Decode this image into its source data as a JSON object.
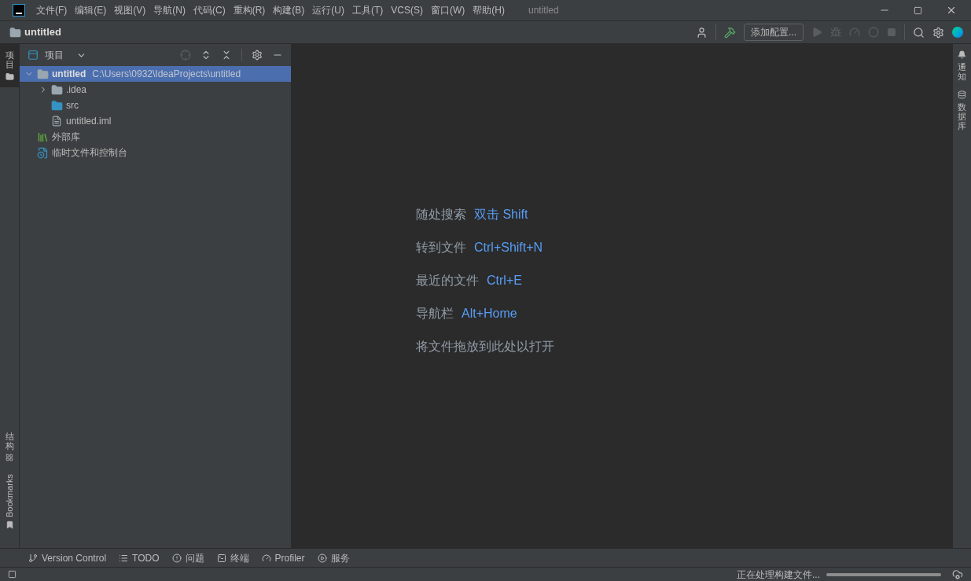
{
  "title_bar": {
    "title": "untitled",
    "menu": [
      "文件(F)",
      "编辑(E)",
      "视图(V)",
      "导航(N)",
      "代码(C)",
      "重构(R)",
      "构建(B)",
      "运行(U)",
      "工具(T)",
      "VCS(S)",
      "窗口(W)",
      "帮助(H)"
    ]
  },
  "nav_bar": {
    "project": "untitled",
    "config_button": "添加配置..."
  },
  "left_stripe": [
    {
      "label": "项目",
      "kind": "cjk",
      "selected": true
    },
    {
      "label": "结构",
      "kind": "cjk",
      "selected": false
    },
    {
      "label": "Bookmarks",
      "kind": "latin",
      "selected": false
    }
  ],
  "project_panel": {
    "title": "项目",
    "tree": [
      {
        "label": "untitled",
        "path": "C:\\Users\\0932\\IdeaProjects\\untitled",
        "kind": "module",
        "expanded": true,
        "selected": true,
        "children": [
          {
            "label": ".idea",
            "kind": "folder",
            "expanded": false,
            "selected": false
          },
          {
            "label": "src",
            "kind": "source",
            "selected": false
          },
          {
            "label": "untitled.iml",
            "kind": "file",
            "selected": false
          }
        ]
      },
      {
        "label": "外部库",
        "kind": "library",
        "selected": false
      },
      {
        "label": "临时文件和控制台",
        "kind": "scratch",
        "selected": false
      }
    ]
  },
  "editor": {
    "hints": [
      {
        "label": "随处搜索",
        "shortcut": "双击 Shift"
      },
      {
        "label": "转到文件",
        "shortcut": "Ctrl+Shift+N"
      },
      {
        "label": "最近的文件",
        "shortcut": "Ctrl+E"
      },
      {
        "label": "导航栏",
        "shortcut": "Alt+Home"
      },
      {
        "label": "将文件拖放到此处以打开"
      }
    ]
  },
  "right_stripe": [
    {
      "label": "通知",
      "kind": "bell"
    },
    {
      "label": "数据库",
      "kind": "database"
    }
  ],
  "tool_windows": [
    {
      "label": "Version Control",
      "kind": "vcs"
    },
    {
      "label": "TODO",
      "kind": "todo"
    },
    {
      "label": "问题",
      "kind": "problems"
    },
    {
      "label": "终端",
      "kind": "terminal"
    },
    {
      "label": "Profiler",
      "kind": "profiler"
    },
    {
      "label": "服务",
      "kind": "services"
    }
  ],
  "status_bar": {
    "message": "正在处理构建文件...",
    "level": 1
  }
}
